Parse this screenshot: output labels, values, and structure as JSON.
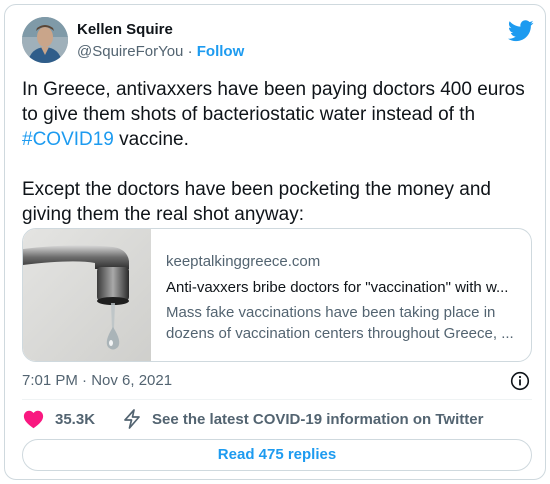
{
  "author": {
    "name": "Kellen Squire",
    "handle": "@SquireForYou",
    "separator": "·",
    "follow_label": "Follow",
    "avatar_icon": "profile-photo"
  },
  "platform_icon": "twitter-bird-icon",
  "tweet": {
    "para1_text": "In Greece, antivaxxers have been paying doctors 400 euros to give them shots of bacteriostatic water instead of th ",
    "hashtag": "#COVID19",
    "para1_end": " vaccine.",
    "para2": "Except the doctors have been pocketing the money and giving them the real shot anyway:"
  },
  "link_card": {
    "domain": "keeptalkinggreece.com",
    "title": "Anti-vaxxers bribe doctors for \"vaccination\" with w...",
    "description_line1": "Mass fake vaccinations have been taking place in",
    "description_line2": "dozens of vaccination centers throughout Greece, ...",
    "thumbnail": "dripping-faucet-image"
  },
  "timestamp": "7:01 PM · Nov 6, 2021",
  "actions": {
    "like_count": "35.3K",
    "covid_info_label": "See the latest COVID-19 information on Twitter"
  },
  "replies_button": "Read 475 replies",
  "colors": {
    "accent": "#1d9bf0",
    "heart": "#f91880",
    "text": "#0f1419",
    "muted": "#536471",
    "border": "#cfd9de"
  }
}
